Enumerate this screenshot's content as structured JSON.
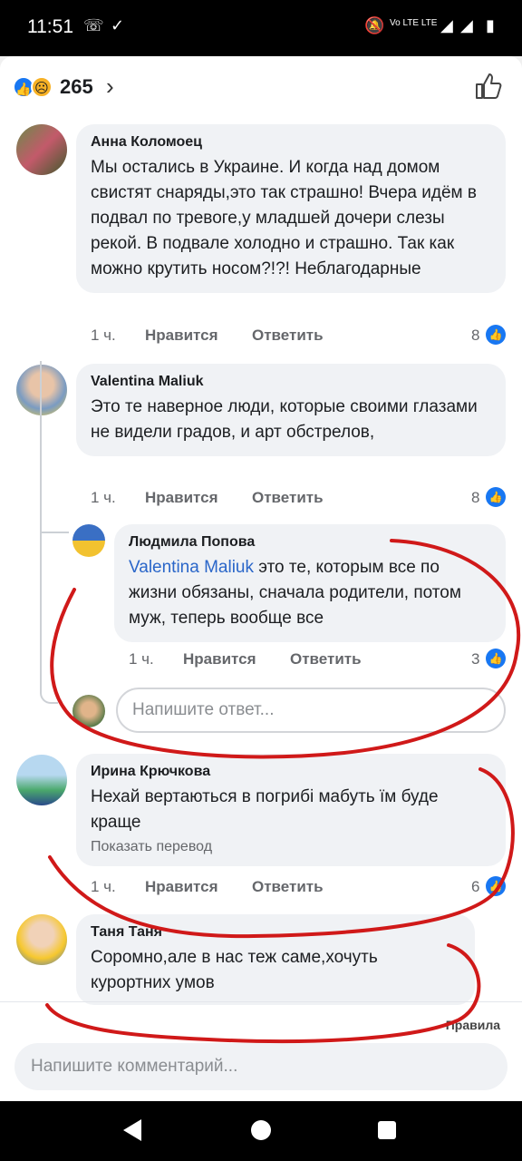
{
  "status_bar": {
    "time": "11:51",
    "network": "Vo LTE LTE"
  },
  "reactions": {
    "count": "265"
  },
  "comments": [
    {
      "author": "Анна Коломоец",
      "text": "Мы остались в Украине. И когда над домом свистят снаряды,это так страшно! Вчера идём в подвал по тревоге,у младшей дочери слезы рекой. В подвале холодно и страшно. Так как можно крутить носом?!?! Неблагодарные",
      "time": "1 ч.",
      "like": "Нравится",
      "reply": "Ответить",
      "reactions": "8"
    },
    {
      "author": "Valentina Maliuk",
      "text": "Это те наверное люди, которые своими глазами не видели градов,  и арт обстрелов,",
      "time": "1 ч.",
      "like": "Нравится",
      "reply": "Ответить",
      "reactions": "8"
    },
    {
      "author": "Людмила Попова",
      "mention": "Valentina Maliuk",
      "text": " это те, которым все по жизни обязаны, сначала родители, потом муж, теперь вообще все",
      "time": "1 ч.",
      "like": "Нравится",
      "reply": "Ответить",
      "reactions": "3"
    },
    {
      "author": "Ирина Крючкова",
      "text": "Нехай вертаються в погрибі мабуть їм буде краще",
      "translate": "Показать перевод",
      "time": "1 ч.",
      "like": "Нравится",
      "reply": "Ответить",
      "reactions": "6"
    },
    {
      "author": "Таня Таня",
      "text": "Соромно,але в нас теж саме,хочуть курортних умов"
    }
  ],
  "reply_input": {
    "placeholder": "Напишите ответ..."
  },
  "rules_link": "Правила",
  "comment_input": {
    "placeholder": "Напишите комментарий..."
  },
  "colors": {
    "accent": "#1877f2",
    "annotation": "#d01919",
    "sad": "#f7b125"
  }
}
